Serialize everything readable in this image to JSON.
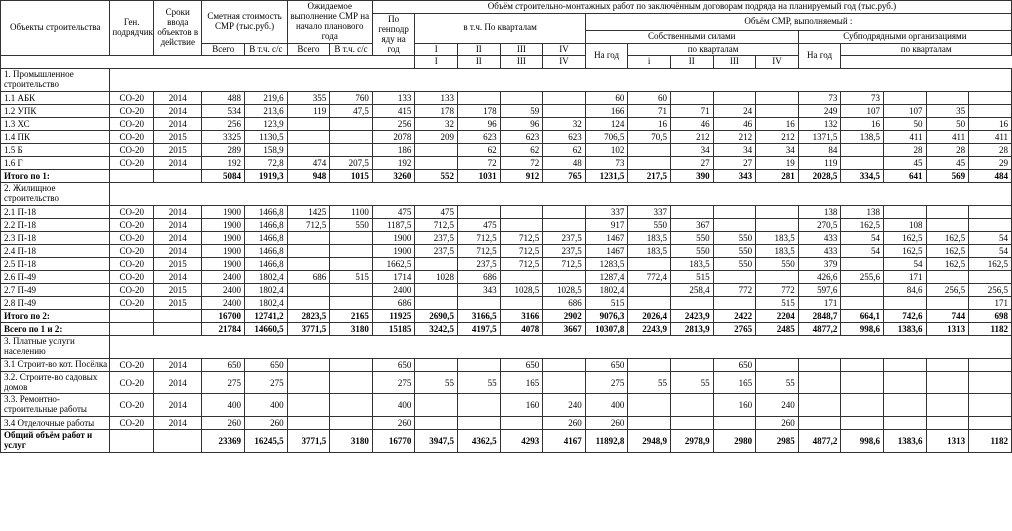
{
  "header": {
    "objects": "Объекты строительства",
    "gen": "Ген. подрядчик",
    "srok": "Сроки ввода объектов в действие",
    "smet": "Сметная стоимость СМР (тыс.руб.)",
    "expected": "Ожидаемое выполнение СМР на начало планового года",
    "volume_top": "Объём строительно-монтажных работ по заключённым договорам подряда на планируемый год (тыс.руб.)",
    "po_gen": "По генподр яду на год",
    "quarters_top": "в т.ч. По кварталам",
    "smr_own_sub": "Объём СМР, выполняемый :",
    "own": "Собственными силами",
    "sub": "Субподрядными организациями",
    "by_q": "по кварталам",
    "total": "Всего",
    "vtcc": "В т.ч. с/с",
    "na_god": "На год",
    "q1u": "I",
    "q2u": "II",
    "q3u": "III",
    "q4u": "IV",
    "q1l": "i",
    "q2l": "II",
    "q3l": "III",
    "q4l": "IV"
  },
  "rows": [
    {
      "t": "section",
      "label": "1. Промышленное строительство"
    },
    {
      "t": "data",
      "label": "1.1 АБК",
      "gen": "СО-20",
      "yr": "2014",
      "v": [
        "488",
        "219,6",
        "355",
        "760",
        "133",
        "133",
        "",
        "",
        "",
        "60",
        "60",
        "",
        "",
        "",
        "73",
        "73",
        "",
        "",
        ""
      ]
    },
    {
      "t": "data",
      "label": "1.2 УПК",
      "gen": "СО-20",
      "yr": "2014",
      "v": [
        "534",
        "213,6",
        "119",
        "47,5",
        "415",
        "178",
        "178",
        "59",
        "",
        "166",
        "71",
        "71",
        "24",
        "",
        "249",
        "107",
        "107",
        "35",
        ""
      ]
    },
    {
      "t": "data",
      "label": "1.3 ХС",
      "gen": "СО-20",
      "yr": "2014",
      "v": [
        "256",
        "123,9",
        "",
        "",
        "256",
        "32",
        "96",
        "96",
        "32",
        "124",
        "16",
        "46",
        "46",
        "16",
        "132",
        "16",
        "50",
        "50",
        "16"
      ]
    },
    {
      "t": "data",
      "label": "1.4 ПК",
      "gen": "СО-20",
      "yr": "2015",
      "v": [
        "3325",
        "1130,5",
        "",
        "",
        "2078",
        "209",
        "623",
        "623",
        "623",
        "706,5",
        "70,5",
        "212",
        "212",
        "212",
        "1371,5",
        "138,5",
        "411",
        "411",
        "411"
      ]
    },
    {
      "t": "data",
      "label": "1.5 Б",
      "gen": "СО-20",
      "yr": "2015",
      "v": [
        "289",
        "158,9",
        "",
        "",
        "186",
        "",
        "62",
        "62",
        "62",
        "102",
        "",
        "34",
        "34",
        "34",
        "84",
        "",
        "28",
        "28",
        "28"
      ]
    },
    {
      "t": "data",
      "label": "1.6 Г",
      "gen": "СО-20",
      "yr": "2014",
      "v": [
        "192",
        "72,8",
        "474",
        "207,5",
        "192",
        "",
        "72",
        "72",
        "48",
        "73",
        "",
        "27",
        "27",
        "19",
        "119",
        "",
        "45",
        "45",
        "29"
      ]
    },
    {
      "t": "total",
      "label": "Итого по 1:",
      "gen": "",
      "yr": "",
      "v": [
        "5084",
        "1919,3",
        "948",
        "1015",
        "3260",
        "552",
        "1031",
        "912",
        "765",
        "1231,5",
        "217,5",
        "390",
        "343",
        "281",
        "2028,5",
        "334,5",
        "641",
        "569",
        "484"
      ]
    },
    {
      "t": "section",
      "label": "2. Жилищное строительство"
    },
    {
      "t": "data",
      "label": "2.1 П-18",
      "gen": "СО-20",
      "yr": "2014",
      "v": [
        "1900",
        "1466,8",
        "1425",
        "1100",
        "475",
        "475",
        "",
        "",
        "",
        "337",
        "337",
        "",
        "",
        "",
        "138",
        "138",
        "",
        "",
        ""
      ]
    },
    {
      "t": "data",
      "label": "2.2 П-18",
      "gen": "СО-20",
      "yr": "2014",
      "v": [
        "1900",
        "1466,8",
        "712,5",
        "550",
        "1187,5",
        "712,5",
        "475",
        "",
        "",
        "917",
        "550",
        "367",
        "",
        "",
        "270,5",
        "162,5",
        "108",
        "",
        ""
      ]
    },
    {
      "t": "data",
      "label": "2.3 П-18",
      "gen": "СО-20",
      "yr": "2014",
      "v": [
        "1900",
        "1466,8",
        "",
        "",
        "1900",
        "237,5",
        "712,5",
        "712,5",
        "237,5",
        "1467",
        "183,5",
        "550",
        "550",
        "183,5",
        "433",
        "54",
        "162,5",
        "162,5",
        "54"
      ]
    },
    {
      "t": "data",
      "label": "2.4 П-18",
      "gen": "СО-20",
      "yr": "2014",
      "v": [
        "1900",
        "1466,8",
        "",
        "",
        "1900",
        "237,5",
        "712,5",
        "712,5",
        "237,5",
        "1467",
        "183,5",
        "550",
        "550",
        "183,5",
        "433",
        "54",
        "162,5",
        "162,5",
        "54"
      ]
    },
    {
      "t": "data",
      "label": "2.5 П-18",
      "gen": "СО-20",
      "yr": "2015",
      "v": [
        "1900",
        "1466,8",
        "",
        "",
        "1662,5",
        "",
        "237,5",
        "712,5",
        "712,5",
        "1283,5",
        "",
        "183,5",
        "550",
        "550",
        "379",
        "",
        "54",
        "162,5",
        "162,5"
      ]
    },
    {
      "t": "data",
      "label": "2.6 П-49",
      "gen": "СО-20",
      "yr": "2014",
      "v": [
        "2400",
        "1802,4",
        "686",
        "515",
        "1714",
        "1028",
        "686",
        "",
        "",
        "1287,4",
        "772,4",
        "515",
        "",
        "",
        "426,6",
        "255,6",
        "171",
        "",
        ""
      ]
    },
    {
      "t": "data",
      "label": "2.7 П-49",
      "gen": "СО-20",
      "yr": "2015",
      "v": [
        "2400",
        "1802,4",
        "",
        "",
        "2400",
        "",
        "343",
        "1028,5",
        "1028,5",
        "1802,4",
        "",
        "258,4",
        "772",
        "772",
        "597,6",
        "",
        "84,6",
        "256,5",
        "256,5"
      ]
    },
    {
      "t": "data",
      "label": "2.8 П-49",
      "gen": "СО-20",
      "yr": "2015",
      "v": [
        "2400",
        "1802,4",
        "",
        "",
        "686",
        "",
        "",
        "",
        "686",
        "515",
        "",
        "",
        "",
        "515",
        "171",
        "",
        "",
        "",
        "171"
      ]
    },
    {
      "t": "total",
      "label": "Итого по 2:",
      "gen": "",
      "yr": "",
      "v": [
        "16700",
        "12741,2",
        "2823,5",
        "2165",
        "11925",
        "2690,5",
        "3166,5",
        "3166",
        "2902",
        "9076,3",
        "2026,4",
        "2423,9",
        "2422",
        "2204",
        "2848,7",
        "664,1",
        "742,6",
        "744",
        "698"
      ]
    },
    {
      "t": "total",
      "label": "Всего по 1 и 2:",
      "gen": "",
      "yr": "",
      "v": [
        "21784",
        "14660,5",
        "3771,5",
        "3180",
        "15185",
        "3242,5",
        "4197,5",
        "4078",
        "3667",
        "10307,8",
        "2243,9",
        "2813,9",
        "2765",
        "2485",
        "4877,2",
        "998,6",
        "1383,6",
        "1313",
        "1182"
      ]
    },
    {
      "t": "section",
      "label": "3. Платные услуги населению"
    },
    {
      "t": "section2",
      "label": "3.1 Строит-во кот. Посёлка",
      "gen": "СО-20",
      "yr": "2014",
      "v": [
        "650",
        "650",
        "",
        "",
        "650",
        "",
        "",
        "650",
        "",
        "650",
        "",
        "",
        "650",
        "",
        "",
        "",
        "",
        "",
        ""
      ]
    },
    {
      "t": "section2",
      "label": "3.2. Строите-во садовых домов",
      "gen": "СО-20",
      "yr": "2014",
      "v": [
        "275",
        "275",
        "",
        "",
        "275",
        "55",
        "55",
        "165",
        "",
        "275",
        "55",
        "55",
        "165",
        "55",
        "",
        "",
        "",
        "",
        ""
      ]
    },
    {
      "t": "section2",
      "label": "3.3. Ремонтно-строительные работы",
      "gen": "СО-20",
      "yr": "2014",
      "v": [
        "400",
        "400",
        "",
        "",
        "400",
        "",
        "",
        "160",
        "240",
        "400",
        "",
        "",
        "160",
        "240",
        "",
        "",
        "",
        "",
        ""
      ]
    },
    {
      "t": "data",
      "label": "3.4 Отделочные работы",
      "gen": "СО-20",
      "yr": "2014",
      "v": [
        "260",
        "260",
        "",
        "",
        "260",
        "",
        "",
        "",
        "260",
        "260",
        "",
        "",
        "",
        "260",
        "",
        "",
        "",
        "",
        ""
      ]
    },
    {
      "t": "total2",
      "label": "Общий объём работ и услуг",
      "gen": "",
      "yr": "",
      "v": [
        "23369",
        "16245,5",
        "3771,5",
        "3180",
        "16770",
        "3947,5",
        "4362,5",
        "4293",
        "4167",
        "11892,8",
        "2948,9",
        "2978,9",
        "2980",
        "2985",
        "4877,2",
        "998,6",
        "1383,6",
        "1313",
        "1182"
      ]
    }
  ]
}
